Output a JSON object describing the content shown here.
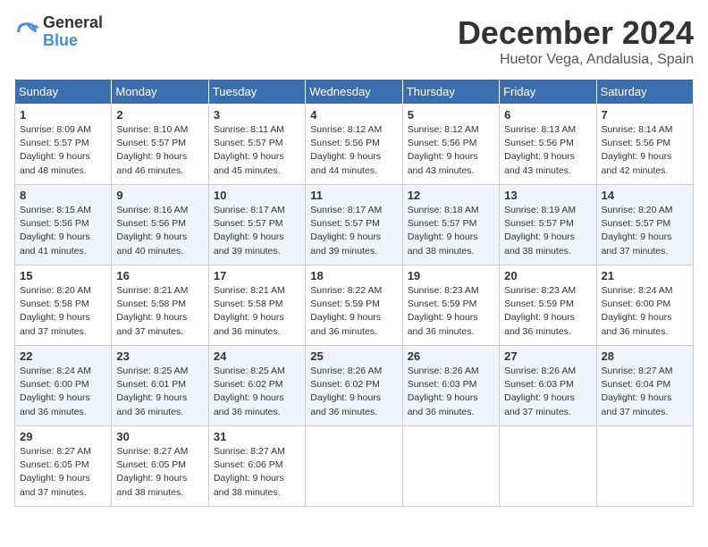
{
  "logo": {
    "general": "General",
    "blue": "Blue"
  },
  "header": {
    "month": "December 2024",
    "location": "Huetor Vega, Andalusia, Spain"
  },
  "weekdays": [
    "Sunday",
    "Monday",
    "Tuesday",
    "Wednesday",
    "Thursday",
    "Friday",
    "Saturday"
  ],
  "weeks": [
    [
      {
        "day": "1",
        "sunrise": "8:09 AM",
        "sunset": "5:57 PM",
        "daylight": "9 hours and 48 minutes."
      },
      {
        "day": "2",
        "sunrise": "8:10 AM",
        "sunset": "5:57 PM",
        "daylight": "9 hours and 46 minutes."
      },
      {
        "day": "3",
        "sunrise": "8:11 AM",
        "sunset": "5:57 PM",
        "daylight": "9 hours and 45 minutes."
      },
      {
        "day": "4",
        "sunrise": "8:12 AM",
        "sunset": "5:56 PM",
        "daylight": "9 hours and 44 minutes."
      },
      {
        "day": "5",
        "sunrise": "8:12 AM",
        "sunset": "5:56 PM",
        "daylight": "9 hours and 43 minutes."
      },
      {
        "day": "6",
        "sunrise": "8:13 AM",
        "sunset": "5:56 PM",
        "daylight": "9 hours and 43 minutes."
      },
      {
        "day": "7",
        "sunrise": "8:14 AM",
        "sunset": "5:56 PM",
        "daylight": "9 hours and 42 minutes."
      }
    ],
    [
      {
        "day": "8",
        "sunrise": "8:15 AM",
        "sunset": "5:56 PM",
        "daylight": "9 hours and 41 minutes."
      },
      {
        "day": "9",
        "sunrise": "8:16 AM",
        "sunset": "5:56 PM",
        "daylight": "9 hours and 40 minutes."
      },
      {
        "day": "10",
        "sunrise": "8:17 AM",
        "sunset": "5:57 PM",
        "daylight": "9 hours and 39 minutes."
      },
      {
        "day": "11",
        "sunrise": "8:17 AM",
        "sunset": "5:57 PM",
        "daylight": "9 hours and 39 minutes."
      },
      {
        "day": "12",
        "sunrise": "8:18 AM",
        "sunset": "5:57 PM",
        "daylight": "9 hours and 38 minutes."
      },
      {
        "day": "13",
        "sunrise": "8:19 AM",
        "sunset": "5:57 PM",
        "daylight": "9 hours and 38 minutes."
      },
      {
        "day": "14",
        "sunrise": "8:20 AM",
        "sunset": "5:57 PM",
        "daylight": "9 hours and 37 minutes."
      }
    ],
    [
      {
        "day": "15",
        "sunrise": "8:20 AM",
        "sunset": "5:58 PM",
        "daylight": "9 hours and 37 minutes."
      },
      {
        "day": "16",
        "sunrise": "8:21 AM",
        "sunset": "5:58 PM",
        "daylight": "9 hours and 37 minutes."
      },
      {
        "day": "17",
        "sunrise": "8:21 AM",
        "sunset": "5:58 PM",
        "daylight": "9 hours and 36 minutes."
      },
      {
        "day": "18",
        "sunrise": "8:22 AM",
        "sunset": "5:59 PM",
        "daylight": "9 hours and 36 minutes."
      },
      {
        "day": "19",
        "sunrise": "8:23 AM",
        "sunset": "5:59 PM",
        "daylight": "9 hours and 36 minutes."
      },
      {
        "day": "20",
        "sunrise": "8:23 AM",
        "sunset": "5:59 PM",
        "daylight": "9 hours and 36 minutes."
      },
      {
        "day": "21",
        "sunrise": "8:24 AM",
        "sunset": "6:00 PM",
        "daylight": "9 hours and 36 minutes."
      }
    ],
    [
      {
        "day": "22",
        "sunrise": "8:24 AM",
        "sunset": "6:00 PM",
        "daylight": "9 hours and 36 minutes."
      },
      {
        "day": "23",
        "sunrise": "8:25 AM",
        "sunset": "6:01 PM",
        "daylight": "9 hours and 36 minutes."
      },
      {
        "day": "24",
        "sunrise": "8:25 AM",
        "sunset": "6:02 PM",
        "daylight": "9 hours and 36 minutes."
      },
      {
        "day": "25",
        "sunrise": "8:26 AM",
        "sunset": "6:02 PM",
        "daylight": "9 hours and 36 minutes."
      },
      {
        "day": "26",
        "sunrise": "8:26 AM",
        "sunset": "6:03 PM",
        "daylight": "9 hours and 36 minutes."
      },
      {
        "day": "27",
        "sunrise": "8:26 AM",
        "sunset": "6:03 PM",
        "daylight": "9 hours and 37 minutes."
      },
      {
        "day": "28",
        "sunrise": "8:27 AM",
        "sunset": "6:04 PM",
        "daylight": "9 hours and 37 minutes."
      }
    ],
    [
      {
        "day": "29",
        "sunrise": "8:27 AM",
        "sunset": "6:05 PM",
        "daylight": "9 hours and 37 minutes."
      },
      {
        "day": "30",
        "sunrise": "8:27 AM",
        "sunset": "6:05 PM",
        "daylight": "9 hours and 38 minutes."
      },
      {
        "day": "31",
        "sunrise": "8:27 AM",
        "sunset": "6:06 PM",
        "daylight": "9 hours and 38 minutes."
      },
      null,
      null,
      null,
      null
    ]
  ],
  "labels": {
    "sunrise": "Sunrise:",
    "sunset": "Sunset:",
    "daylight": "Daylight:"
  }
}
